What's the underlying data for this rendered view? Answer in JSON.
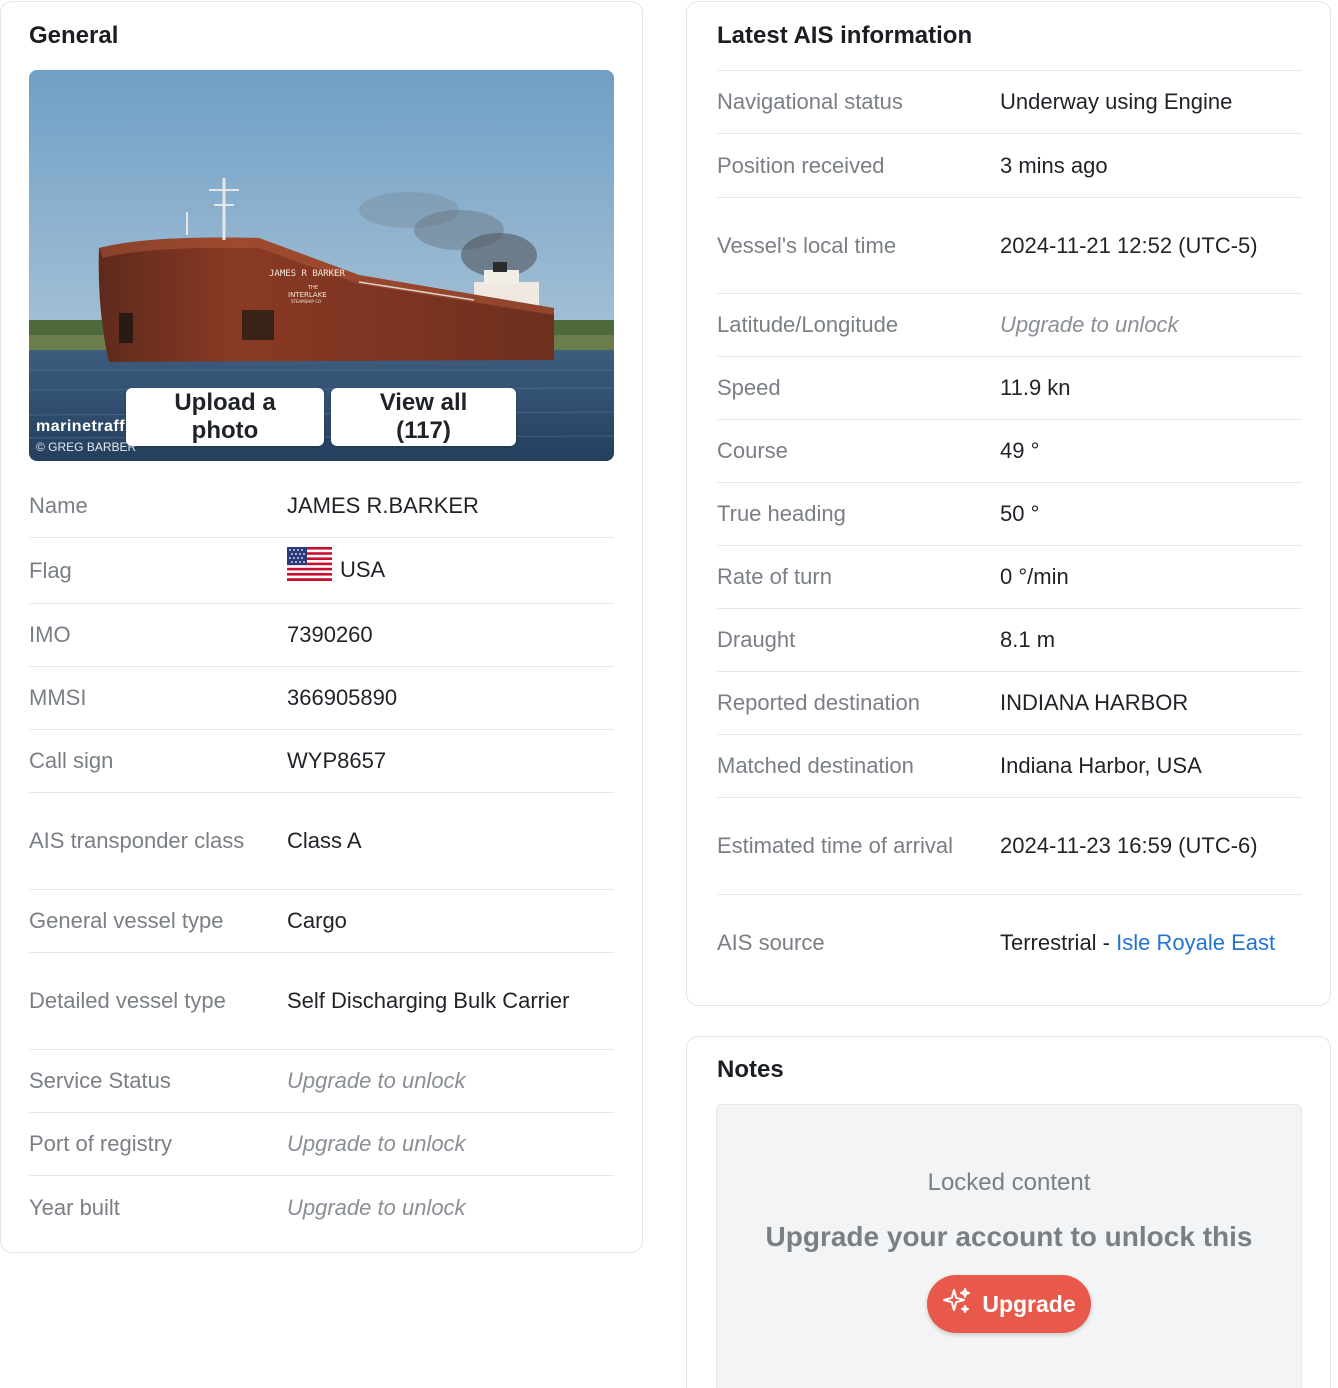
{
  "general": {
    "title": "General",
    "photo": {
      "upload_label": "Upload a photo",
      "view_all_label": "View all (117)",
      "watermark": "marinetraffic",
      "credit": "© GREG BARBER",
      "hull_name": "JAMES R BARKER",
      "hull_company_1": "THE",
      "hull_company_2": "INTERLAKE",
      "hull_company_3": "STEAMSHIP CO"
    },
    "rows": [
      {
        "label": "Name",
        "value": "JAMES R.BARKER"
      },
      {
        "label": "Flag",
        "value": "USA",
        "icon": "us-flag-icon"
      },
      {
        "label": "IMO",
        "value": "7390260"
      },
      {
        "label": "MMSI",
        "value": "366905890"
      },
      {
        "label": "Call sign",
        "value": "WYP8657"
      },
      {
        "label": "AIS transponder class",
        "value": "Class A"
      },
      {
        "label": "General vessel type",
        "value": "Cargo"
      },
      {
        "label": "Detailed vessel type",
        "value": "Self Discharging Bulk Carrier"
      },
      {
        "label": "Service Status",
        "value": "Upgrade to unlock"
      },
      {
        "label": "Port of registry",
        "value": "Upgrade to unlock"
      },
      {
        "label": "Year built",
        "value": "Upgrade to unlock"
      }
    ]
  },
  "ais": {
    "title": "Latest AIS information",
    "rows": [
      {
        "label": "Navigational status",
        "value": "Underway using Engine"
      },
      {
        "label": "Position received",
        "value": "3 mins ago"
      },
      {
        "label": "Vessel's local time",
        "value": "2024-11-21 12:52 (UTC-5)"
      },
      {
        "label": "Latitude/Longitude",
        "value": "Upgrade to unlock"
      },
      {
        "label": "Speed",
        "value": "11.9 kn"
      },
      {
        "label": "Course",
        "value": "49 °"
      },
      {
        "label": "True heading",
        "value": "50 °"
      },
      {
        "label": "Rate of turn",
        "value": "0 °/min"
      },
      {
        "label": "Draught",
        "value": "8.1 m"
      },
      {
        "label": "Reported destination",
        "value": "INDIANA HARBOR"
      },
      {
        "label": "Matched destination",
        "value": "Indiana Harbor, USA"
      },
      {
        "label": "Estimated time of arrival",
        "value": "2024-11-23 16:59 (UTC-6)"
      },
      {
        "label": "AIS source",
        "value_prefix": "Terrestrial - ",
        "value_link": "Isle Royale East"
      }
    ]
  },
  "notes": {
    "title": "Notes",
    "locked_title": "Locked content",
    "locked_message": "Upgrade your account to unlock this",
    "upgrade_label": "Upgrade",
    "upgrade_icon": "sparkle-icon"
  },
  "colors": {
    "upgrade": "#e8594b",
    "link": "#2473d1",
    "label": "#7a7f86"
  }
}
